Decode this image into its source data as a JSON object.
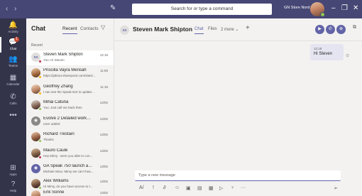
{
  "topbar": {
    "back": "‹",
    "forward": "›",
    "compose_icon": "compose-icon",
    "search_placeholder": "Search for or type a command",
    "org_name": "GN Store Nord ⌄",
    "minimize": "–",
    "restore": "❐",
    "close": "✕"
  },
  "rail": [
    {
      "icon": "bell-icon",
      "glyph": "🔔",
      "label": "Activity"
    },
    {
      "icon": "chat-icon",
      "glyph": "💬",
      "label": "Chat",
      "badge": "1"
    },
    {
      "icon": "teams-icon",
      "glyph": "👥",
      "label": "Teams"
    },
    {
      "icon": "calendar-icon",
      "glyph": "▦",
      "label": "Calendar"
    },
    {
      "icon": "calls-icon",
      "glyph": "✆",
      "label": "Calls"
    },
    {
      "icon": "more-icon",
      "glyph": "•••",
      "label": ""
    },
    {
      "icon": "apps-icon",
      "glyph": "⊞",
      "label": "Apps"
    },
    {
      "icon": "help-icon",
      "glyph": "?",
      "label": "Help"
    }
  ],
  "chatpane": {
    "title": "Chat",
    "tab_recent": "Recent",
    "tab_contacts": "Contacts",
    "filter_icon": "filter-icon",
    "recent_label": "Recent",
    "items": [
      {
        "name": "Steven Mark Shipton",
        "preview": "You: Hi Steven",
        "time": "12:18",
        "initials": "SS"
      },
      {
        "name": "Priscilla Vayra Mensah",
        "preview": "https://jabra4.sharepoint.com/sites/...",
        "time": "11:55"
      },
      {
        "name": "Geoffrey Zhang",
        "preview": "I can see the Speak 510 is update...",
        "time": "11:16"
      },
      {
        "name": "Mihai Catuna",
        "preview": "You: Just call me back then",
        "time": "14/02"
      },
      {
        "name": "Evolve 2 Detailed worksh...",
        "preview": "User added",
        "time": "14/02"
      },
      {
        "name": "Richard Trestain",
        "preview": "Thanks",
        "time": "13/02"
      },
      {
        "name": "Mauro Caule",
        "preview": "Hey Mimy - were you able to con...",
        "time": "13/02"
      },
      {
        "name": "GA Speak 750 launch an...",
        "preview": "Michael Skou: Mimy we can't hea...",
        "time": "13/02"
      },
      {
        "name": "Alex Williams",
        "preview": "Hi Mimy, do you have access to t...",
        "time": "13/02"
      },
      {
        "name": "Erik Sonne",
        "preview": "",
        "time": "13/02"
      }
    ]
  },
  "main": {
    "initials": "SS",
    "name": "Steven Mark Shipton",
    "tabs": [
      "Chat",
      "Files",
      "2 more ⌄"
    ],
    "add": "+",
    "calls": [
      "▶",
      "✆",
      "⊕"
    ],
    "popout": "⧉"
  },
  "message": {
    "time": "12:18",
    "text": "Hi Steven",
    "seen": "⊙"
  },
  "compose": {
    "placeholder": "Type a new message",
    "tools": [
      "A/",
      "!",
      "∂",
      "☺",
      "▣",
      "▤",
      "▦",
      "▷",
      "♀",
      "···"
    ],
    "send": "➢"
  }
}
